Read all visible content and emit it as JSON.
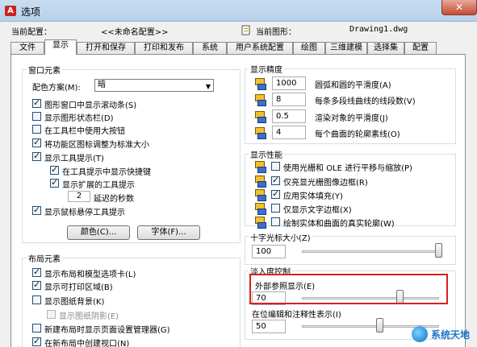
{
  "window": {
    "title": "选项",
    "app_icon_text": "A",
    "close_symbol": "✕"
  },
  "config": {
    "current_profile_label": "当前配置：",
    "current_profile_value": "<<未命名配置>>",
    "current_drawing_label": "当前图形：",
    "current_drawing_value": "Drawing1.dwg"
  },
  "tabs": [
    "文件",
    "显示",
    "打开和保存",
    "打印和发布",
    "系统",
    "用户系统配置",
    "绘图",
    "三维建模",
    "选择集",
    "配置"
  ],
  "active_tab": "显示",
  "window_elements": {
    "title": "窗口元素",
    "color_scheme_label": "配色方案(M):",
    "color_scheme_value": "暗",
    "checkboxes": [
      {
        "label": "图形窗口中显示滚动条(S)",
        "checked": true
      },
      {
        "label": "显示图形状态栏(D)",
        "checked": false
      },
      {
        "label": "在工具栏中使用大按钮",
        "checked": false
      },
      {
        "label": "将功能区图标调整为标准大小",
        "checked": true
      },
      {
        "label": "显示工具提示(T)",
        "checked": true
      },
      {
        "label": "在工具提示中显示快捷键",
        "checked": true
      },
      {
        "label": "显示扩展的工具提示",
        "checked": true
      },
      {
        "label": "显示鼠标悬停工具提示",
        "checked": true
      }
    ],
    "delay_value": "2",
    "delay_label": "延迟的秒数",
    "colors_button": "颜色(C)...",
    "fonts_button": "字体(F)..."
  },
  "layout_elements": {
    "title": "布局元素",
    "checkboxes": [
      {
        "label": "显示布局和模型选项卡(L)",
        "checked": true
      },
      {
        "label": "显示可打印区域(B)",
        "checked": true
      },
      {
        "label": "显示图纸背景(K)",
        "checked": false
      },
      {
        "label": "显示图纸阴影(E)",
        "checked": false,
        "disabled": true
      },
      {
        "label": "新建布局时显示页面设置管理器(G)",
        "checked": false
      },
      {
        "label": "在新布局中创建视口(N)",
        "checked": true
      }
    ]
  },
  "display_resolution": {
    "title": "显示精度",
    "rows": [
      {
        "value": "1000",
        "label": "圆弧和圆的平滑度(A)"
      },
      {
        "value": "8",
        "label": "每条多段线曲线的线段数(V)"
      },
      {
        "value": "0.5",
        "label": "渲染对象的平滑度(J)"
      },
      {
        "value": "4",
        "label": "每个曲面的轮廓素线(O)"
      }
    ]
  },
  "display_performance": {
    "title": "显示性能",
    "checkboxes": [
      {
        "label": "使用光栅和 OLE 进行平移与缩放(P)",
        "checked": false
      },
      {
        "label": "仅亮显光栅图像边框(R)",
        "checked": true
      },
      {
        "label": "应用实体填充(Y)",
        "checked": true
      },
      {
        "label": "仅显示文字边框(X)",
        "checked": false
      },
      {
        "label": "绘制实体和曲面的真实轮廓(W)",
        "checked": false
      }
    ]
  },
  "crosshair": {
    "title": "十字光标大小(Z)",
    "value": "100",
    "level": 100
  },
  "fade": {
    "title": "淡入度控制",
    "xref_label": "外部参照显示(E)",
    "xref_value": "70",
    "xref_level": 70,
    "inplace_label": "在位编辑和注释性表示(I)",
    "inplace_value": "50",
    "inplace_level": 50
  },
  "watermark": {
    "text": "系统天地"
  }
}
